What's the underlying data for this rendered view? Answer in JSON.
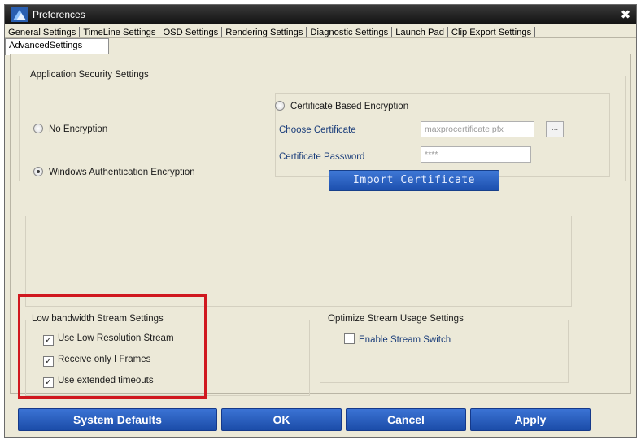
{
  "window": {
    "title": "Preferences",
    "close_glyph": "✖",
    "app_icon": "preferences-app-icon"
  },
  "tabs": {
    "row1": [
      "General Settings",
      "TimeLine Settings",
      "OSD Settings",
      "Rendering Settings",
      "Diagnostic Settings",
      "Launch Pad",
      "Clip Export Settings"
    ],
    "active": "AdvancedSettings"
  },
  "security": {
    "group_title": "Application Security Settings",
    "no_encryption": "No Encryption",
    "windows_auth": "Windows Authentication Encryption",
    "certificate_based": "Certificate Based Encryption",
    "selected": "windows_auth",
    "choose_certificate_label": "Choose Certificate",
    "choose_certificate_value": "maxprocertificate.pfx",
    "browse_label": "...",
    "certificate_password_label": "Certificate Password",
    "certificate_password_value": "****",
    "import_button": "Import Certificate"
  },
  "low_bandwidth": {
    "group_title": "Low bandwidth Stream Settings",
    "items": [
      {
        "label": "Use Low Resolution Stream",
        "checked": true
      },
      {
        "label": "Receive only I Frames",
        "checked": true
      },
      {
        "label": "Use extended timeouts",
        "checked": true
      }
    ]
  },
  "optimize": {
    "group_title": "Optimize Stream Usage Settings",
    "enable_stream_switch": {
      "label": "Enable Stream Switch",
      "checked": false
    }
  },
  "footer": {
    "system_defaults": "System Defaults",
    "ok": "OK",
    "cancel": "Cancel",
    "apply": "Apply"
  },
  "colors": {
    "dialog_bg": "#ece9d8",
    "button_blue": "#1b4ca8",
    "highlight_red": "#d0181f",
    "field_label": "#1a3d7a"
  }
}
